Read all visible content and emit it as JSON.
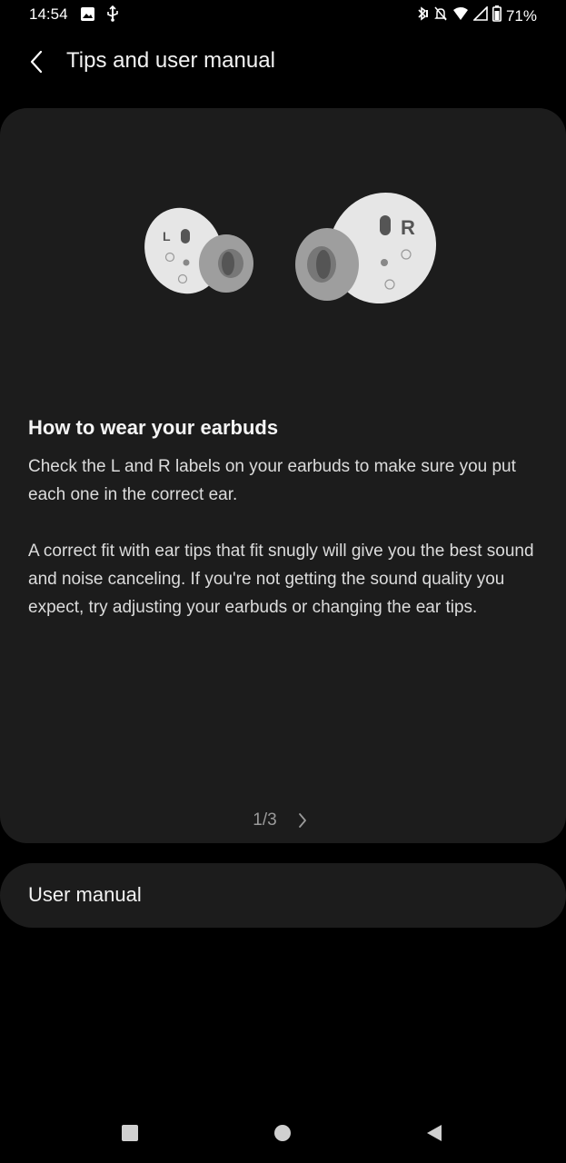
{
  "status_bar": {
    "time": "14:54",
    "battery": "71%",
    "icons_left": [
      "image-icon",
      "usb-icon"
    ],
    "icons_right": [
      "bluetooth-icon",
      "mute-icon",
      "wifi-icon",
      "signal-icon",
      "battery-icon"
    ]
  },
  "header": {
    "title": "Tips and user manual"
  },
  "tip": {
    "title": "How to wear your earbuds",
    "paragraph1": "Check the L and R labels on your earbuds to make sure you put each one in the correct ear.",
    "paragraph2": "A correct fit with ear tips that fit snugly will give you the best sound and noise canceling. If you're not getting the sound quality you expect, try adjusting your earbuds or changing the ear tips.",
    "page_indicator": "1/3",
    "illustration": {
      "left_label": "L",
      "right_label": "R"
    }
  },
  "user_manual": {
    "label": "User manual"
  },
  "colors": {
    "background": "#000000",
    "card": "#1c1c1c",
    "earbud_body": "#e6e6e6",
    "ear_tip": "#9e9e9e"
  }
}
